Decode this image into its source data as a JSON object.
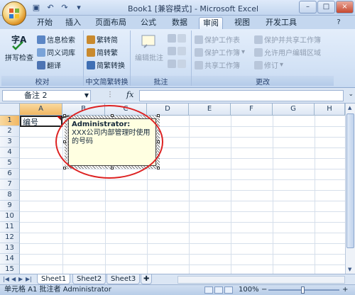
{
  "title": "Book1 [兼容模式] - Microsoft Excel",
  "window_buttons": [
    "–",
    "□",
    "×"
  ],
  "tabs": [
    "开始",
    "插入",
    "页面布局",
    "公式",
    "数据",
    "审阅",
    "视图",
    "开发工具"
  ],
  "active_tab": "审阅",
  "ribbon": {
    "proofing": {
      "label": "校对",
      "spell": "拼写检查",
      "research": "信息检索",
      "thesaurus": "同义词库",
      "translate": "翻译"
    },
    "chinese_conversion": {
      "label": "中文简繁转换",
      "to_simplified": "繁转简",
      "to_traditional": "简转繁",
      "convert": "简繁转换"
    },
    "comments": {
      "label": "批注",
      "edit": "编辑批注"
    },
    "changes": {
      "label": "更改",
      "protect_sheet": "保护工作表",
      "protect_workbook": "保护工作簿",
      "share_workbook": "共享工作簿",
      "protect_share": "保护并共享工作簿",
      "allow_edit": "允许用户编辑区域",
      "track": "修订"
    }
  },
  "formula_bar": {
    "name_box": "备注 2",
    "fx": "fx",
    "value": ""
  },
  "grid": {
    "columns": [
      "A",
      "B",
      "C",
      "D",
      "E",
      "F",
      "G",
      "H"
    ],
    "rows": [
      "1",
      "2",
      "3",
      "4",
      "5",
      "6",
      "7",
      "8",
      "9",
      "10",
      "11",
      "12",
      "13",
      "14",
      "15"
    ],
    "cell_A1": "编号"
  },
  "comment": {
    "author": "Administrator:",
    "text": "XXX公司内部管理时使用的号码"
  },
  "sheets": [
    "Sheet1",
    "Sheet2",
    "Sheet3"
  ],
  "active_sheet": "Sheet1",
  "status": {
    "text": "单元格 A1 批注者 Administrator",
    "zoom": "100%"
  },
  "colors": {
    "annotation_ellipse": "#dd2222",
    "comment_fill": "#ffffe1",
    "indicator": "#dd0000"
  }
}
